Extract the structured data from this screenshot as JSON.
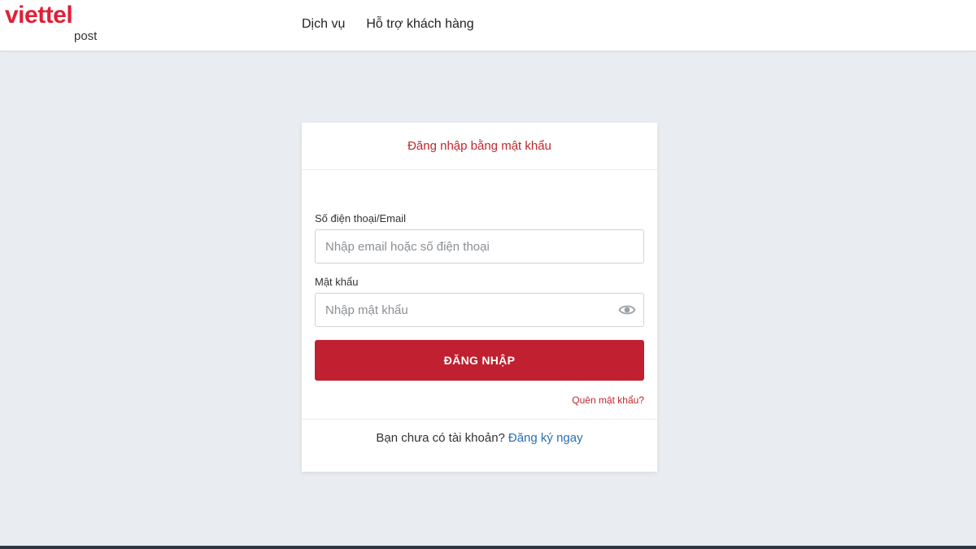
{
  "header": {
    "logo": {
      "main": "viettel",
      "sub": "post"
    },
    "nav": [
      "Dịch vụ",
      "Hỗ trợ khách hàng"
    ]
  },
  "login": {
    "title": "Đăng nhập bằng mật khẩu",
    "phone_email": {
      "label": "Số điện thoại/Email",
      "value": "",
      "placeholder": "Nhập email hoặc số điện thoại"
    },
    "password": {
      "label": "Mật khẩu",
      "value": "",
      "placeholder": "Nhập mật khẩu",
      "icon": "eye-icon"
    },
    "submit_label": "ĐĂNG NHẬP",
    "forgot_label": "Quên mật khẩu?",
    "footer": {
      "prompt": "Bạn chưa có tài khoản?",
      "register_label": "Đăng ký ngay"
    }
  },
  "colors": {
    "brand_red": "#c0202f",
    "logo_red": "#e01f36",
    "link_blue": "#2a6fb3",
    "page_bg": "#e9ecf1"
  }
}
